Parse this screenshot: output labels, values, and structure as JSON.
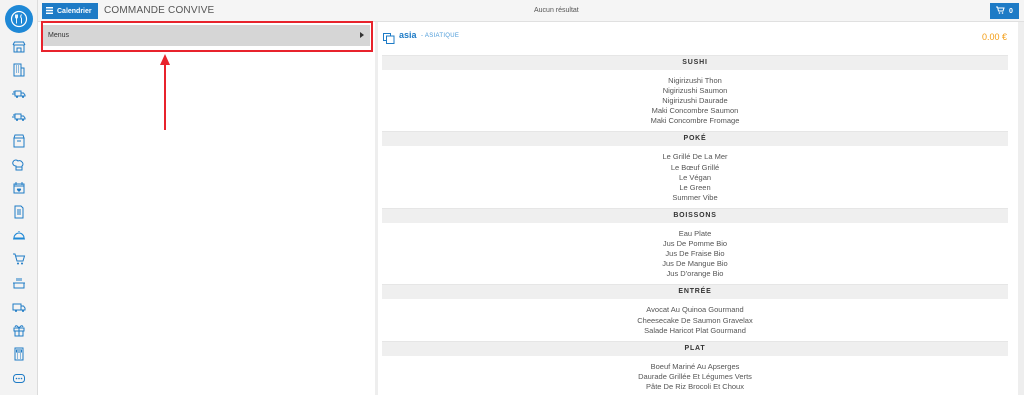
{
  "sidebar": {
    "logo_icon": "fork-knife-logo-icon",
    "icons": [
      "store-icon",
      "building-icon",
      "truck-fast-icon",
      "truck-fast-icon",
      "box-icon",
      "chef-hat-icon",
      "calendar-heart-icon",
      "document-icon",
      "cloche-icon",
      "cart-icon",
      "cooking-pot-icon",
      "delivery-truck-icon",
      "gift-icon",
      "calculator-icon",
      "chat-icon"
    ]
  },
  "header": {
    "calendar_label": "Calendrier",
    "title": "COMMANDE CONVIVE",
    "status": "Aucun résultat",
    "cart_count": "0"
  },
  "left": {
    "menus_label": "Menus"
  },
  "shop": {
    "name": "asia",
    "category": "- ASIATIQUE",
    "price": "0.00 €"
  },
  "sections": [
    {
      "title": "SUSHI",
      "items": [
        "Nigirizushi Thon",
        "Nigirizushi Saumon",
        "Nigirizushi Daurade",
        "Maki Concombre Saumon",
        "Maki Concombre Fromage"
      ]
    },
    {
      "title": "POKÉ",
      "items": [
        "Le Grillé De La Mer",
        "Le Bœuf Grillé",
        "Le Végan",
        "Le Green",
        "Summer Vibe"
      ]
    },
    {
      "title": "BOISSONS",
      "items": [
        "Eau Plate",
        "Jus De Pomme Bio",
        "Jus De Fraise Bio",
        "Jus De Mangue Bio",
        "Jus D'orange Bio"
      ]
    },
    {
      "title": "ENTRÉE",
      "items": [
        "Avocat Au Quinoa Gourmand",
        "Cheesecake De Saumon Gravelax",
        "Salade Haricot Plat Gourmand"
      ]
    },
    {
      "title": "PLAT",
      "items": [
        "Boeuf Mariné Au Apserges",
        "Daurade Grillée Et Légumes Verts",
        "Pâte De Riz Brocoli Et Choux"
      ]
    }
  ]
}
